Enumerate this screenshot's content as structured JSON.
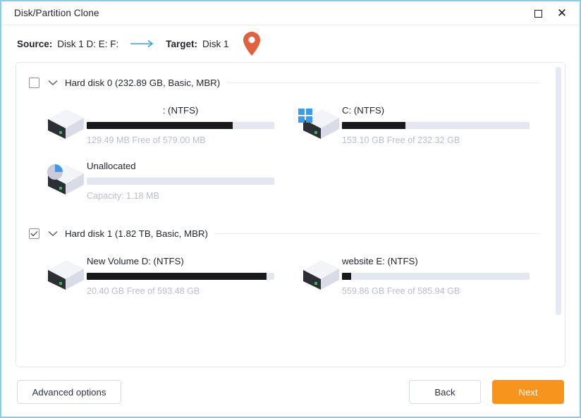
{
  "window": {
    "title": "Disk/Partition Clone",
    "border_color": "#84cdee",
    "buttons": {
      "maximize": "maximize-icon",
      "close": "close-icon"
    }
  },
  "summary": {
    "source_label": "Source:",
    "source_value": "Disk 1 D: E: F:",
    "arrow_icon": "arrow-right-icon",
    "target_label": "Target:",
    "target_value": "Disk 1",
    "pin_icon": "map-pin-icon",
    "pin_color": "#e2603e"
  },
  "disks": [
    {
      "id": "hard-disk-0",
      "checked": false,
      "expanded": true,
      "title": "Hard disk 0 (232.89 GB, Basic, MBR)",
      "partitions": [
        {
          "id": "partition-ntfs-unnamed",
          "name": ": (NTFS)",
          "name_centered": true,
          "icon": "disk-drive-icon",
          "used_percent": 78,
          "capacity_text": "129.49 MB Free of 579.00 MB"
        },
        {
          "id": "partition-c",
          "name": "C: (NTFS)",
          "name_centered": false,
          "icon": "windows-disk-icon",
          "used_percent": 34,
          "capacity_text": "153.10 GB Free of 232.32 GB"
        },
        {
          "id": "partition-unallocated",
          "name": "Unallocated",
          "name_centered": false,
          "icon": "unallocated-disk-icon",
          "used_percent": 0,
          "capacity_text": "Capacity: 1.18 MB"
        }
      ]
    },
    {
      "id": "hard-disk-1",
      "checked": true,
      "expanded": true,
      "title": "Hard disk 1 (1.82 TB, Basic, MBR)",
      "partitions": [
        {
          "id": "partition-d",
          "name": "New Volume D: (NTFS)",
          "name_centered": false,
          "icon": "disk-drive-icon",
          "used_percent": 96,
          "capacity_text": "20.40 GB Free of 593.48 GB"
        },
        {
          "id": "partition-e",
          "name": "website E: (NTFS)",
          "name_centered": false,
          "icon": "disk-drive-icon",
          "used_percent": 5,
          "capacity_text": "559.86 GB Free of 585.94 GB"
        }
      ]
    }
  ],
  "scrollbar": {
    "thumb_top_percent": 1,
    "thumb_height_percent": 84
  },
  "footer": {
    "advanced_label": "Advanced options",
    "back_label": "Back",
    "next_label": "Next",
    "next_color": "#f7941e"
  }
}
